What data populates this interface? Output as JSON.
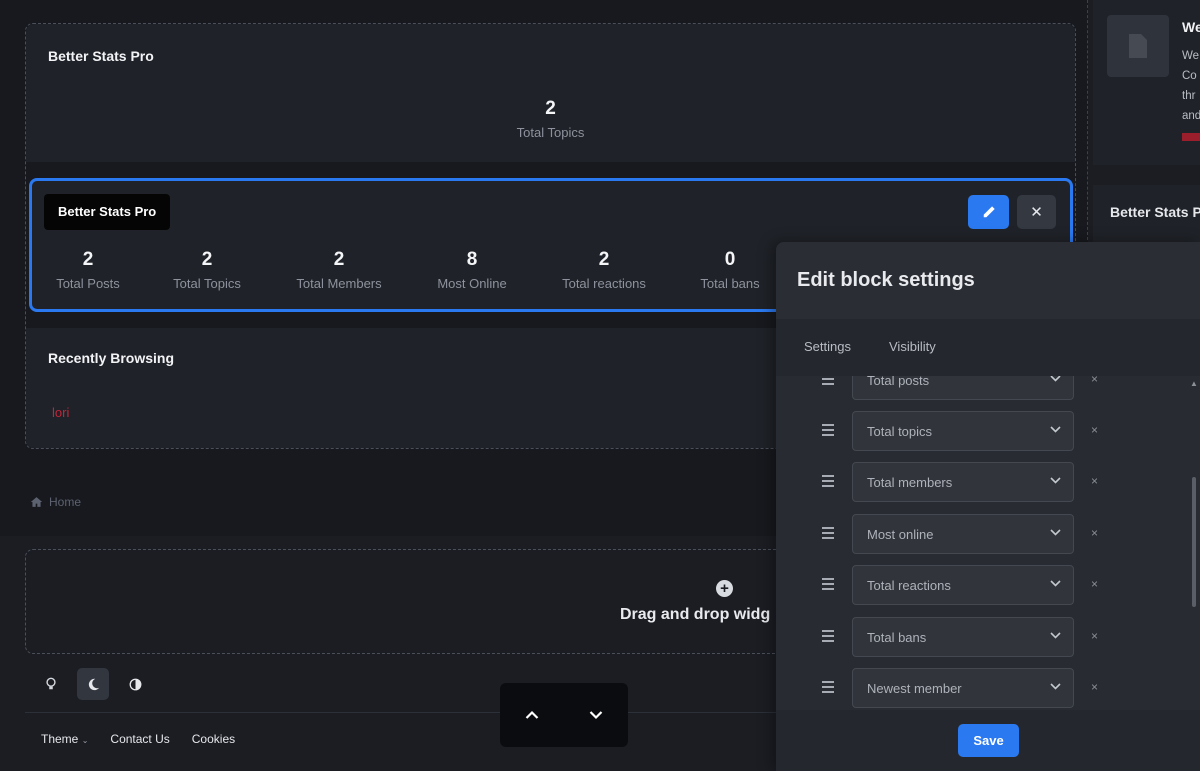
{
  "main": {
    "block1": {
      "title": "Better Stats Pro",
      "stat": {
        "value": "2",
        "label": "Total Topics"
      }
    },
    "block2": {
      "badge": "Better Stats Pro",
      "stats": [
        {
          "value": "2",
          "label": "Total Posts"
        },
        {
          "value": "2",
          "label": "Total Topics"
        },
        {
          "value": "2",
          "label": "Total Members"
        },
        {
          "value": "8",
          "label": "Most Online"
        },
        {
          "value": "2",
          "label": "Total reactions"
        },
        {
          "value": "0",
          "label": "Total bans"
        }
      ]
    },
    "block3": {
      "title": "Recently Browsing",
      "user": "lori"
    }
  },
  "breadcrumb": {
    "home_label": "Home"
  },
  "dropzone": {
    "text": "Drag and drop widg"
  },
  "footer": {
    "links": [
      "Theme",
      "Contact Us",
      "Cookies"
    ]
  },
  "sidebar": {
    "card1": {
      "title": "We",
      "lines": [
        "We",
        "Co",
        "thr",
        "and"
      ]
    },
    "card2": {
      "title": "Better Stats Pr"
    }
  },
  "modal": {
    "title": "Edit block settings",
    "tabs": [
      "Settings",
      "Visibility"
    ],
    "rows": [
      "Total posts",
      "Total topics",
      "Total members",
      "Most online",
      "Total reactions",
      "Total bans",
      "Newest member"
    ],
    "remove_glyph": "×",
    "save_label": "Save"
  },
  "colors": {
    "accent": "#2b79f0",
    "background": "#1b1d23",
    "panel": "#1f2228",
    "danger": "#c0263a"
  }
}
